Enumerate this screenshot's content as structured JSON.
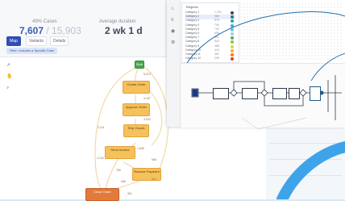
{
  "header": {
    "metric1_label": "49% Cases",
    "metric1_value": "7,607",
    "metric1_total": "/ 15,903",
    "metric2_label": "Average duration",
    "metric2_value": "2 wk 1 d"
  },
  "toolbar": {
    "items": [
      "Map",
      "Variants",
      "Details"
    ]
  },
  "filter": {
    "label": "Filter: Includes a Specific Case"
  },
  "process_map": {
    "start_label": "Start",
    "nodes": [
      "Create Order",
      "Approve Order",
      "Ship Goods",
      "Send Invoice",
      "Receive Payment",
      "Close Order"
    ],
    "edge_labels": [
      "5,212",
      "4,187",
      "3,020",
      "2,114",
      "1,845",
      "1,102",
      "906",
      "780",
      "612",
      "455",
      "301"
    ]
  },
  "map_window": {
    "legend_title": "Regions",
    "legend": [
      {
        "label": "Category 1",
        "value": "1,204",
        "color": "#2f4858"
      },
      {
        "label": "Category 2",
        "value": "988",
        "color": "#1f7a8c"
      },
      {
        "label": "Category 3",
        "value": "876",
        "color": "#20a39e"
      },
      {
        "label": "Category 4",
        "value": "754",
        "color": "#3ab0d9"
      },
      {
        "label": "Category 5",
        "value": "702",
        "color": "#6fc2e5"
      },
      {
        "label": "Category 6",
        "value": "655",
        "color": "#9ad1e8"
      },
      {
        "label": "Category 7",
        "value": "591",
        "color": "#4caf50"
      },
      {
        "label": "Category 8",
        "value": "540",
        "color": "#8bc34a"
      },
      {
        "label": "Category 9",
        "value": "488",
        "color": "#cddc39"
      },
      {
        "label": "Category 10",
        "value": "410",
        "color": "#ffb300"
      },
      {
        "label": "Category 11",
        "value": "362",
        "color": "#f57c00"
      },
      {
        "label": "Category 12",
        "value": "298",
        "color": "#e53935"
      }
    ],
    "selected_index": 1
  },
  "colors": {
    "accent": "#2f4fb4",
    "node_fill": "#f6c15a",
    "node_start": "#49a84b",
    "node_end": "#e17a3a",
    "arc": "#1e6fae",
    "big_arc": "#3fa3ea"
  },
  "icons": {
    "left_toolbar": [
      "cursor-icon",
      "hand-icon",
      "zoom-icon"
    ],
    "map_sidebar": [
      "home-icon",
      "layers-icon",
      "pin-icon",
      "settings-icon"
    ]
  }
}
